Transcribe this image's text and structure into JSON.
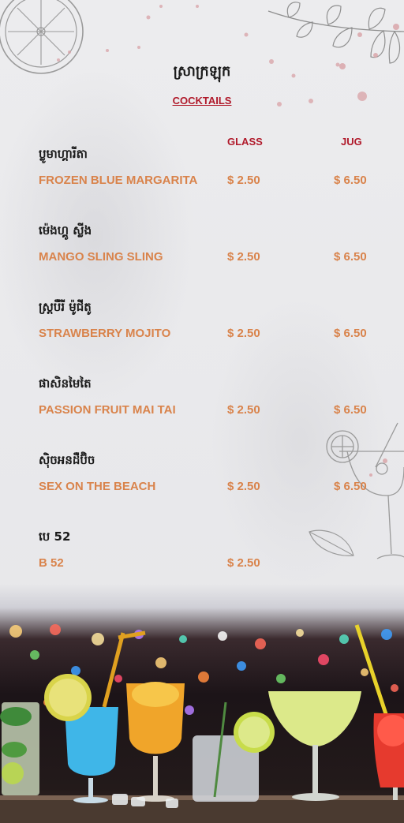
{
  "header": {
    "title_km": "ស្រាក្រឡុក",
    "title_en": "COCKTAILS"
  },
  "columns": {
    "glass": "GLASS",
    "jug": "JUG"
  },
  "items": [
    {
      "name_km": "ប្លូមាហ្គារីតា",
      "name_en": "FROZEN BLUE MARGARITA",
      "glass": "$ 2.50",
      "jug": "$ 6.50"
    },
    {
      "name_km": "ម៉េងហ្គូ ស្លីង",
      "name_en": "MANGO SLING SLING",
      "glass": "$ 2.50",
      "jug": "$ 6.50"
    },
    {
      "name_km": "ស្ត្របឺរី ម៉ូជីតូ",
      "name_en": "STRAWBERRY MOJITO",
      "glass": "$ 2.50",
      "jug": "$ 6.50"
    },
    {
      "name_km": "ផាសិនមៃតៃ",
      "name_en": "PASSION FRUIT MAI TAI",
      "glass": "$ 2.50",
      "jug": "$ 6.50"
    },
    {
      "name_km": "ស៊ិចអនដឺប៊ិច",
      "name_en": "SEX ON THE BEACH",
      "glass": "$ 2.50",
      "jug": "$ 6.50"
    },
    {
      "name_km": "បេ 52",
      "name_en": "B 52",
      "glass": "$ 2.50",
      "jug": ""
    }
  ],
  "colors": {
    "accent_red": "#b0192a",
    "price_orange": "#d9834b",
    "text_dark": "#1b1b1b",
    "background": "#e8e8ea"
  },
  "icons": [
    "lemon-slice-icon",
    "branch-leaves-icon",
    "cocktail-glass-icon",
    "leaf-icon"
  ]
}
